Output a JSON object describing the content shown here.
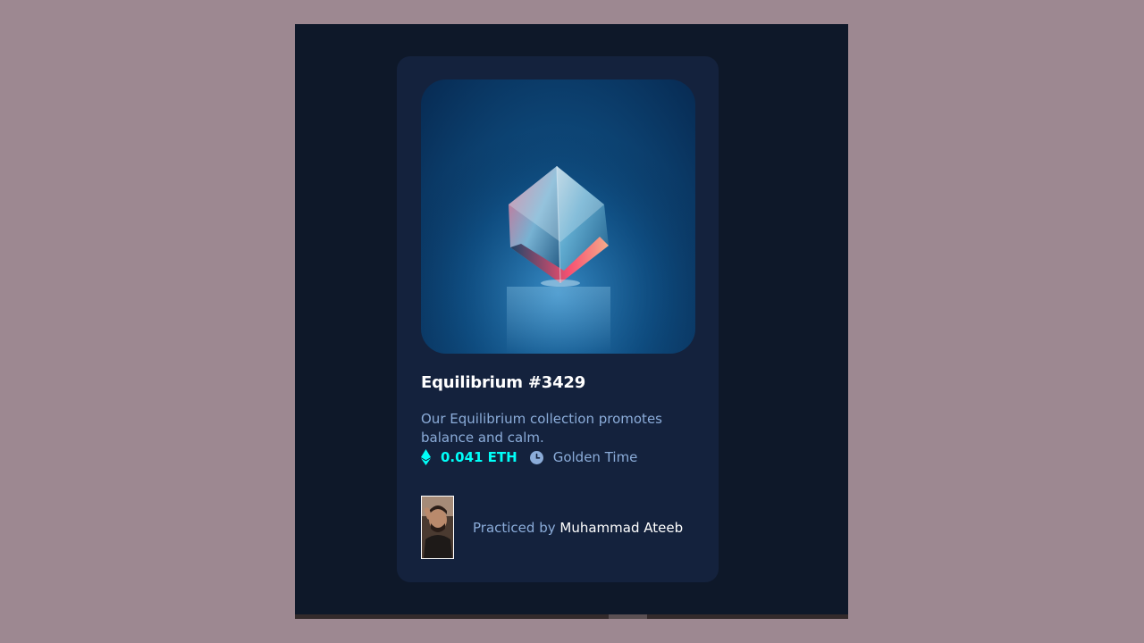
{
  "card": {
    "title": "Equilibrium #3429",
    "description": "Our Equilibrium collection promotes balance and calm.",
    "price": "0.041 ETH",
    "time": "Golden Time",
    "credit_prefix": "Practiced by ",
    "credit_name": "Muhammad Ateeb",
    "image_alt": "Equilibrium cube artwork",
    "avatar_alt": "Muhammad Ateeb avatar"
  },
  "icons": {
    "price": "ethereum-icon",
    "time": "clock-icon"
  },
  "colors": {
    "page_background": "#9d8891",
    "main_background": "#0e1829",
    "card_background": "#14223d",
    "accent_cyan": "#00fff8",
    "soft_blue": "#8bacd9",
    "white": "#ffffff"
  }
}
